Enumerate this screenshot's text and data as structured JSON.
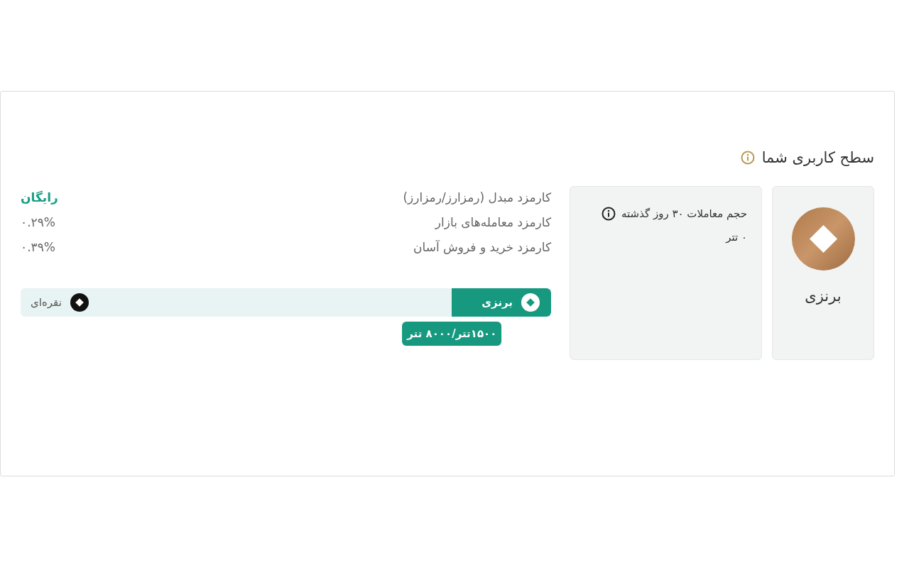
{
  "section": {
    "title": "سطح کاربری شما"
  },
  "current_level": {
    "name": "برنزی"
  },
  "volume": {
    "label": "حجم معاملات ۳۰ روز گذشته",
    "value": "۰ تتر"
  },
  "fees": [
    {
      "label": "کارمزد مبدل (رمزارز/رمزارز)",
      "value": "رایگان",
      "kind": "free"
    },
    {
      "label": "کارمزد معامله‌های بازار",
      "value": "۰.۲۹%",
      "kind": "rate"
    },
    {
      "label": "کارمزد خرید و فروش آسان",
      "value": "۰.۳۹%",
      "kind": "rate"
    }
  ],
  "progress": {
    "level": 0.187,
    "tooltip": "۱۵۰۰تتر/۸۰۰۰ تتر",
    "levels": [
      {
        "name": "برنزی",
        "reached": true
      },
      {
        "name": "نقره‌ای",
        "reached": false
      }
    ]
  }
}
